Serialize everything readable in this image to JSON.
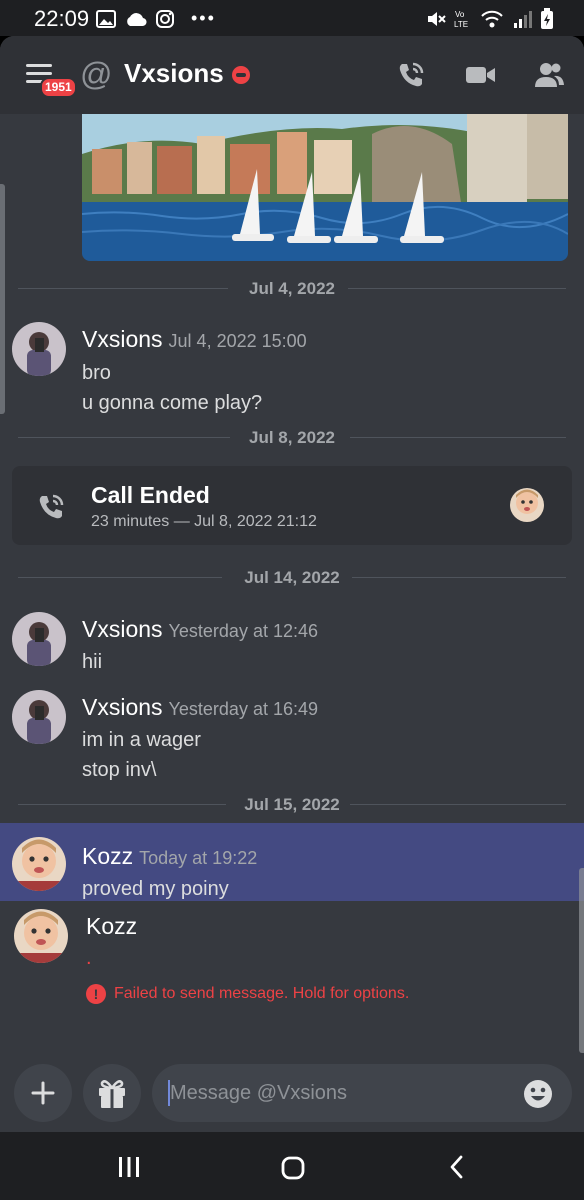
{
  "status_bar": {
    "time": "22:09"
  },
  "header": {
    "menu_badge": "1951",
    "title": "Vxsions"
  },
  "dividers": [
    "Jul 4, 2022",
    "Jul 8, 2022",
    "Jul 14, 2022",
    "Jul 15, 2022"
  ],
  "messages": [
    {
      "author": "Vxsions",
      "timestamp": "Jul 4, 2022 15:00",
      "lines": [
        "bro",
        "u gonna come play?"
      ]
    },
    {
      "author": "Vxsions",
      "timestamp": "Yesterday at 12:46",
      "lines": [
        "hii"
      ]
    },
    {
      "author": "Vxsions",
      "timestamp": "Yesterday at 16:49",
      "lines": [
        "im in a wager",
        "stop inv\\"
      ]
    },
    {
      "author": "Kozz",
      "timestamp": "Today at 19:22",
      "lines": [
        "proved my poiny"
      ]
    },
    {
      "author": "Kozz",
      "timestamp": "",
      "lines": [
        "."
      ]
    }
  ],
  "call": {
    "title": "Call Ended",
    "subtitle": "23 minutes — Jul 8, 2022 21:12"
  },
  "failed_notice": "Failed to send message. Hold for options.",
  "composer": {
    "placeholder": "Message @Vxsions"
  },
  "colors": {
    "accent": "#7289da",
    "danger": "#ed4245",
    "highlight": "#444a82",
    "background": "#36393f"
  }
}
